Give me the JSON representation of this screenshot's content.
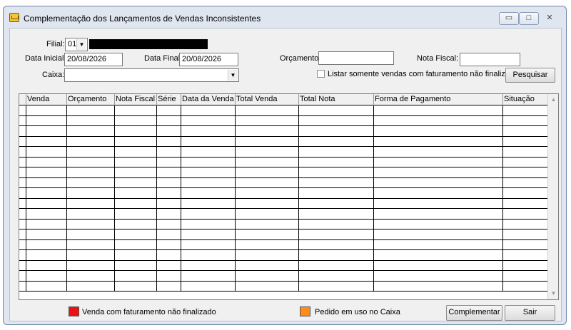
{
  "window": {
    "title": "Complementação dos Lançamentos de Vendas Inconsistentes",
    "min_glyph": "▭",
    "max_glyph": "□",
    "close_glyph": "✕"
  },
  "filters": {
    "filial_label": "Filial:",
    "filial_value": "01",
    "data_inicial_label": "Data Inicial:",
    "data_inicial_value": "20/08/2026",
    "data_final_label": "Data Final:",
    "data_final_value": "20/08/2026",
    "orcamento_label": "Orçamento:",
    "orcamento_value": "",
    "nota_fiscal_label": "Nota Fiscal:",
    "nota_fiscal_value": "",
    "caixa_label": "Caixa:",
    "caixa_value": "",
    "listar_label": "Listar somente vendas  com faturamento não finalizado",
    "listar_checked": false,
    "pesquisar_label": "Pesquisar"
  },
  "grid": {
    "columns": [
      "Venda",
      "Orçamento",
      "Nota Fiscal",
      "Série",
      "Data da Venda",
      "Total Venda",
      "Total Nota",
      "Forma de Pagamento",
      "Situação"
    ],
    "rows": [],
    "empty_row_count": 18
  },
  "legend": [
    {
      "label": "Venda com faturamento não finalizado",
      "color": "#ee1111"
    },
    {
      "label": "Pedido em uso no Caixa",
      "color": "#ff8c1a"
    }
  ],
  "actions": {
    "complementar_label": "Complementar",
    "sair_label": "Sair"
  },
  "icons": {
    "dropdown": "▼",
    "scroll_up": "▲",
    "scroll_down": "▼"
  }
}
